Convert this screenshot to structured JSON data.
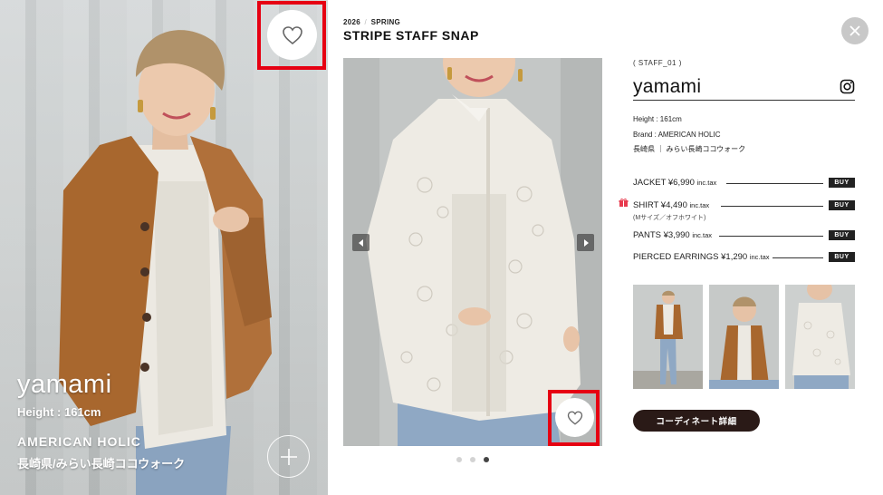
{
  "left_card": {
    "name": "yamami",
    "height": "Height : 161cm",
    "brand": "AMERICAN HOLIC",
    "location": "長崎県/みらい長崎ココウォーク",
    "favorite_icon": "heart-outline-icon",
    "plus_icon": "plus-icon"
  },
  "modal": {
    "season_year": "2026",
    "season_slash": "/",
    "season_name": "SPRING",
    "title": "STRIPE STAFF SNAP",
    "close_icon": "close-icon",
    "carousel": {
      "prev_icon": "arrow-left-icon",
      "next_icon": "arrow-right-icon",
      "dots": [
        false,
        false,
        true
      ],
      "favorite_icon": "heart-outline-icon"
    },
    "staff": {
      "tag": "( STAFF_01 )",
      "name": "yamami",
      "height": "Height : 161cm",
      "brand": "Brand : AMERICAN HOLIC",
      "store": "長崎県 ｜ みらい長崎ココウォーク",
      "instagram_icon": "instagram-icon"
    },
    "items": [
      {
        "name": "JACKET ¥6,990",
        "tax": "inc.tax",
        "buy": "BUY"
      },
      {
        "name": "SHIRT ¥4,490",
        "tax": "inc.tax",
        "buy": "BUY",
        "note": "(Mサイズ／オフホワイト)"
      },
      {
        "name": "PANTS ¥3,990",
        "tax": "inc.tax",
        "buy": "BUY"
      },
      {
        "name": "PIERCED EARRINGS ¥1,290",
        "tax": "inc.tax",
        "buy": "BUY"
      }
    ],
    "gift_icon": "gift-icon",
    "coordinate_button": "コーディネート詳細"
  },
  "colors": {
    "highlight_red": "#e60012",
    "button_dark": "#2a1a17",
    "buy_bg": "#222222"
  }
}
